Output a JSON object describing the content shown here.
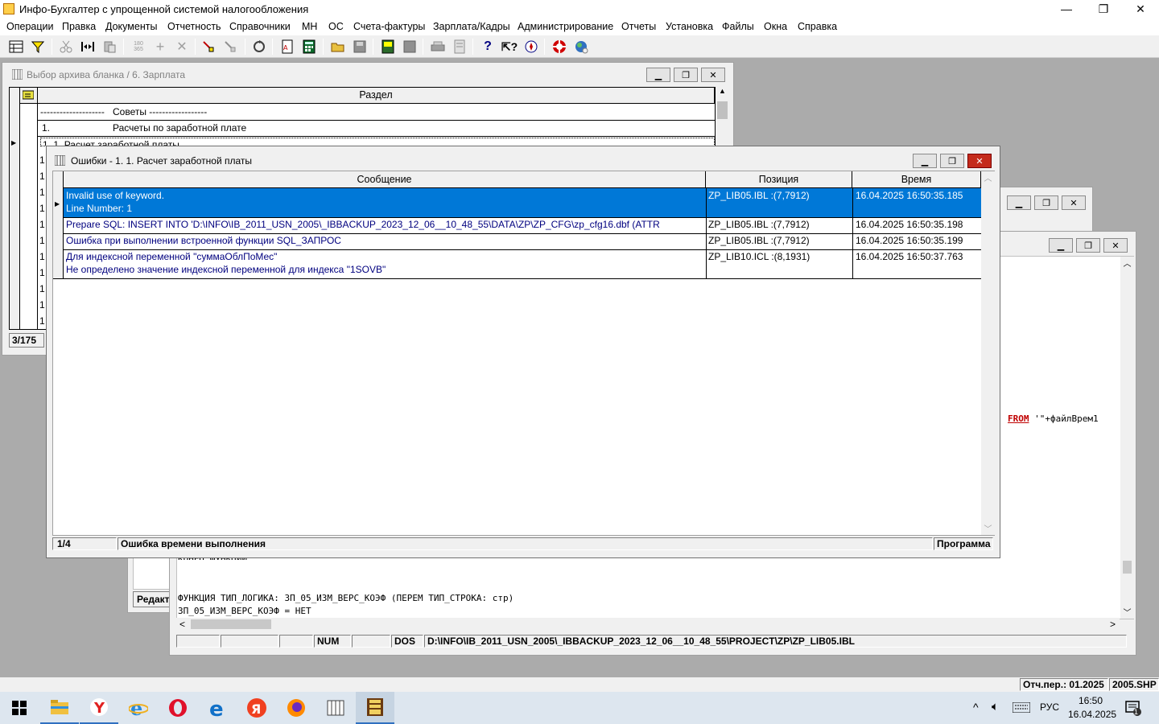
{
  "app": {
    "title": "Инфо-Бухгалтер с упрощенной системой налогообложения",
    "window_controls": {
      "minimize": "—",
      "maximize": "❐",
      "close": "✕"
    }
  },
  "menu": [
    "Операции",
    "Правка",
    "Документы",
    "Отчетность",
    "Справочники",
    "МН",
    "ОС",
    "Счета-фактуры",
    "Зарплата/Кадры",
    "Администрирование",
    "Отчеты",
    "Установка",
    "Файлы",
    "Окна",
    "Справка"
  ],
  "archive_window": {
    "title": "Выбор архива бланка /     6. Зарплата",
    "column_header": "Раздел",
    "rows": [
      {
        "num": "--------------------",
        "text": "Советы  ------------------"
      },
      {
        "num": "1.",
        "text": "Расчеты по заработной плате"
      },
      {
        "num": "1. 1.",
        "text": "Расчет заработной платы"
      }
    ],
    "left_col_marks": [
      "1",
      "1",
      "1",
      "1",
      "1",
      "1",
      "1",
      "1",
      "1",
      "1",
      "1",
      "1"
    ],
    "counter": "3/175"
  },
  "errors_window": {
    "title": "Ошибки - 1. 1. Расчет заработной платы",
    "columns": {
      "message": "Сообщение",
      "position": "Позиция",
      "time": "Время"
    },
    "rows": [
      {
        "message": "Invalid use of keyword.",
        "message2": "Line Number: 1",
        "position": "ZP_LIB05.IBL :(7,7912)",
        "time": "16.04.2025 16:50:35.185"
      },
      {
        "message": "Prepare SQL: INSERT INTO 'D:\\INFO\\IB_2011_USN_2005\\_IBBACKUP_2023_12_06__10_48_55\\DATA\\ZP\\ZP_CFG\\zp_cfg16.dbf (ATTR",
        "message2": "",
        "position": "ZP_LIB05.IBL :(7,7912)",
        "time": "16.04.2025 16:50:35.198"
      },
      {
        "message": "Ошибка при выполнении встроенной функции SQL_ЗАПРОС",
        "message2": "",
        "position": "ZP_LIB05.IBL :(7,7912)",
        "time": "16.04.2025 16:50:35.199"
      },
      {
        "message": "Для индексной переменной \"суммаОблПоМес\"",
        "message2": "Не определено значение индексной переменной для индекса \"1SOVB\"",
        "position": "ZP_LIB10.ICL :(8,1931)",
        "time": "16.04.2025 16:50:37.763"
      }
    ],
    "status": {
      "counter": "1/4",
      "type": "Ошибка времени выполнения",
      "source": "Программа"
    }
  },
  "editor": {
    "code_fragment": {
      "keyword": "FROM",
      "rest": "'\"+файлВрем1"
    },
    "lines": [
      "КОНЕЦ_ФУНКЦИИ",
      "",
      "",
      "ФУНКЦИЯ ТИП_ЛОГИКА: ЗП_05_ИЗМ_ВЕРС_КОЭФ (ПЕРЕМ ТИП_СТРОКА: стр)",
      "ЗП_05_ИЗМ_ВЕРС_КОЭФ = НЕТ"
    ],
    "status": {
      "num": "NUM",
      "dos": "DOS",
      "path": "D:\\INFO\\IB_2011_USN_2005\\_IBBACKUP_2023_12_06__10_48_55\\PROJECT\\ZP\\ZP_LIB05.IBL"
    }
  },
  "mid_window": {
    "label": "Редакт"
  },
  "app_status": {
    "period": "Отч.пер.: 01.2025",
    "file": "2005.SHP"
  },
  "taskbar": {
    "lang": "РУС",
    "time": "16:50",
    "date": "16.04.2025",
    "notification_count": "1",
    "tray_arrow": "^"
  }
}
